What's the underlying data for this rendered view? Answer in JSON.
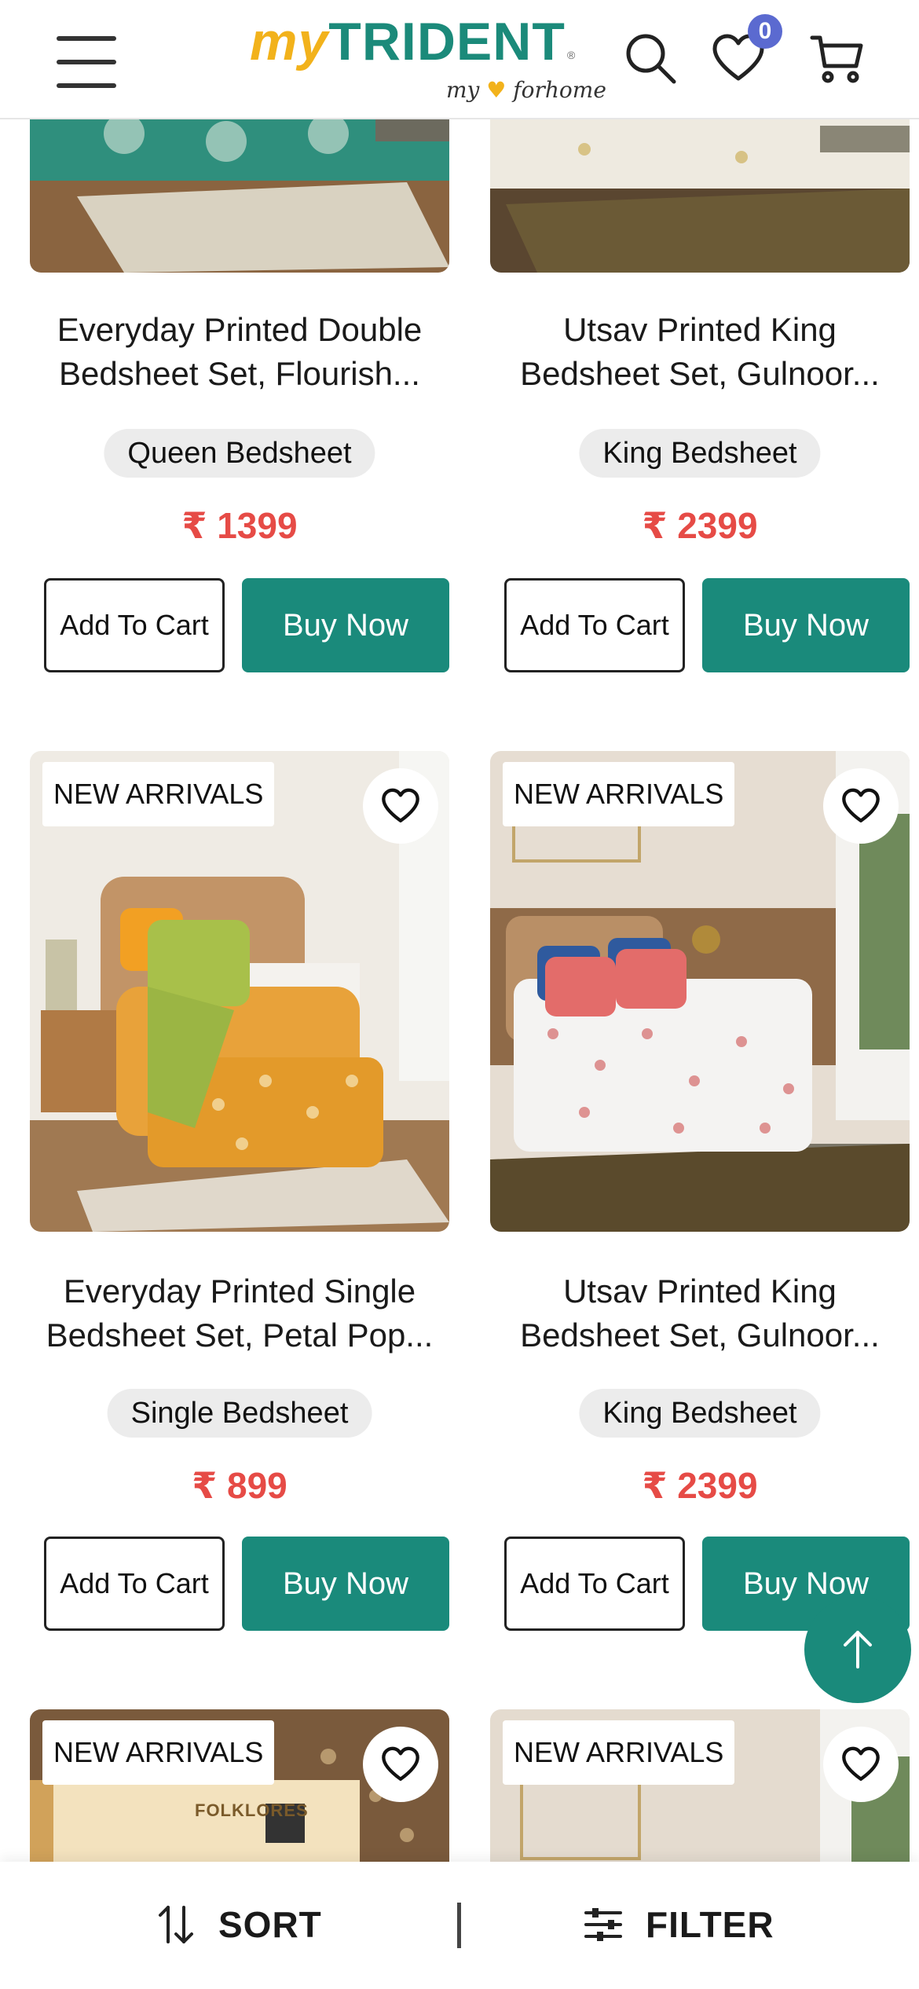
{
  "header": {
    "logo": {
      "my": "my",
      "brand": "TRIDENT",
      "tm": "®",
      "tag_my": "my",
      "tag_for": "forhome"
    },
    "wishlist_count": "0",
    "icons": [
      "menu-icon",
      "search-icon",
      "heart-icon",
      "cart-icon"
    ]
  },
  "products": [
    {
      "title_line1": "Everyday Printed Double",
      "title_line2": "Bedsheet Set, Flourish...",
      "size": "Queen Bedsheet",
      "price": "₹ 1399",
      "add_to_cart": "Add To Cart",
      "buy_now": "Buy Now"
    },
    {
      "title_line1": "Utsav Printed King",
      "title_line2": "Bedsheet Set, Gulnoor...",
      "size": "King Bedsheet",
      "price": "₹ 2399",
      "add_to_cart": "Add To Cart",
      "buy_now": "Buy Now"
    },
    {
      "badge": "NEW ARRIVALS",
      "title_line1": "Everyday Printed Single",
      "title_line2": "Bedsheet Set, Petal Pop...",
      "size": "Single Bedsheet",
      "price": "₹ 899",
      "add_to_cart": "Add To Cart",
      "buy_now": "Buy Now"
    },
    {
      "badge": "NEW ARRIVALS",
      "title_line1": "Utsav Printed King",
      "title_line2": "Bedsheet Set, Gulnoor...",
      "size": "King Bedsheet",
      "price": "₹ 2399",
      "add_to_cart": "Add To Cart",
      "buy_now": "Buy Now"
    },
    {
      "badge": "NEW ARRIVALS",
      "box_text": "FOLKLORES"
    },
    {
      "badge": "NEW ARRIVALS"
    }
  ],
  "bottom_bar": {
    "sort_label": "SORT",
    "filter_label": "FILTER"
  },
  "colors": {
    "brand_teal": "#1a8a7b",
    "brand_yellow": "#f2b21b",
    "price_red": "#e64b46",
    "badge_blue": "#5b6ad0"
  }
}
